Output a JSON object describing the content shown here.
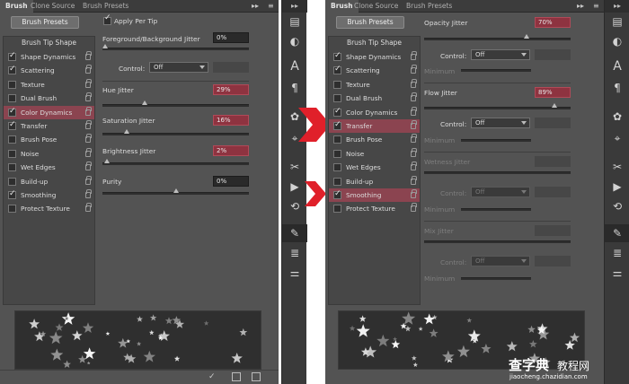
{
  "left_panel": {
    "tabs": [
      "Brush",
      "Clone Source",
      "Brush Presets"
    ],
    "brush_presets_button": "Brush Presets",
    "list_header": "Brush Tip Shape",
    "items": [
      {
        "label": "Shape Dynamics",
        "checked": true,
        "highlighted": false
      },
      {
        "label": "Scattering",
        "checked": true,
        "highlighted": false
      },
      {
        "label": "Texture",
        "checked": false,
        "highlighted": false
      },
      {
        "label": "Dual Brush",
        "checked": false,
        "highlighted": false
      },
      {
        "label": "Color Dynamics",
        "checked": true,
        "highlighted": true
      },
      {
        "label": "Transfer",
        "checked": true,
        "highlighted": false
      },
      {
        "label": "Brush Pose",
        "checked": false,
        "highlighted": false
      },
      {
        "label": "Noise",
        "checked": false,
        "highlighted": false
      },
      {
        "label": "Wet Edges",
        "checked": false,
        "highlighted": false
      },
      {
        "label": "Build-up",
        "checked": false,
        "highlighted": false
      },
      {
        "label": "Smoothing",
        "checked": true,
        "highlighted": false
      },
      {
        "label": "Protect Texture",
        "checked": false,
        "highlighted": false
      }
    ],
    "settings": {
      "apply_per_tip": "Apply Per Tip",
      "fg_bg_jitter_label": "Foreground/Background Jitter",
      "fg_bg_jitter_value": "0%",
      "control_label": "Control:",
      "control_value": "Off",
      "hue_jitter_label": "Hue Jitter",
      "hue_jitter_value": "29%",
      "saturation_jitter_label": "Saturation Jitter",
      "saturation_jitter_value": "16%",
      "brightness_jitter_label": "Brightness Jitter",
      "brightness_jitter_value": "2%",
      "purity_label": "Purity",
      "purity_value": "0%"
    }
  },
  "right_panel": {
    "tabs": [
      "Brush",
      "Clone Source",
      "Brush Presets"
    ],
    "brush_presets_button": "Brush Presets",
    "list_header": "Brush Tip Shape",
    "items": [
      {
        "label": "Shape Dynamics",
        "checked": true,
        "highlighted": false
      },
      {
        "label": "Scattering",
        "checked": true,
        "highlighted": false
      },
      {
        "label": "Texture",
        "checked": false,
        "highlighted": false
      },
      {
        "label": "Dual Brush",
        "checked": false,
        "highlighted": false
      },
      {
        "label": "Color Dynamics",
        "checked": true,
        "highlighted": false
      },
      {
        "label": "Transfer",
        "checked": true,
        "highlighted": true
      },
      {
        "label": "Brush Pose",
        "checked": false,
        "highlighted": false
      },
      {
        "label": "Noise",
        "checked": false,
        "highlighted": false
      },
      {
        "label": "Wet Edges",
        "checked": false,
        "highlighted": false
      },
      {
        "label": "Build-up",
        "checked": false,
        "highlighted": false
      },
      {
        "label": "Smoothing",
        "checked": true,
        "highlighted": true
      },
      {
        "label": "Protect Texture",
        "checked": false,
        "highlighted": false
      }
    ],
    "settings": {
      "opacity_jitter_label": "Opacity Jitter",
      "opacity_jitter_value": "70%",
      "control_label": "Control:",
      "control_value": "Off",
      "minimum_label": "Minimum",
      "flow_jitter_label": "Flow Jitter",
      "flow_jitter_value": "89%",
      "wetness_jitter_label": "Wetness Jitter",
      "mix_jitter_label": "Mix Jitter"
    }
  },
  "colors": {
    "panel_bg": "#535353",
    "highlight_red": "#8e3340",
    "arrow_red": "#e0202a"
  },
  "watermark": {
    "main": "查字典",
    "sub": "教程网",
    "url": "jiaocheng.chazidian.com"
  }
}
